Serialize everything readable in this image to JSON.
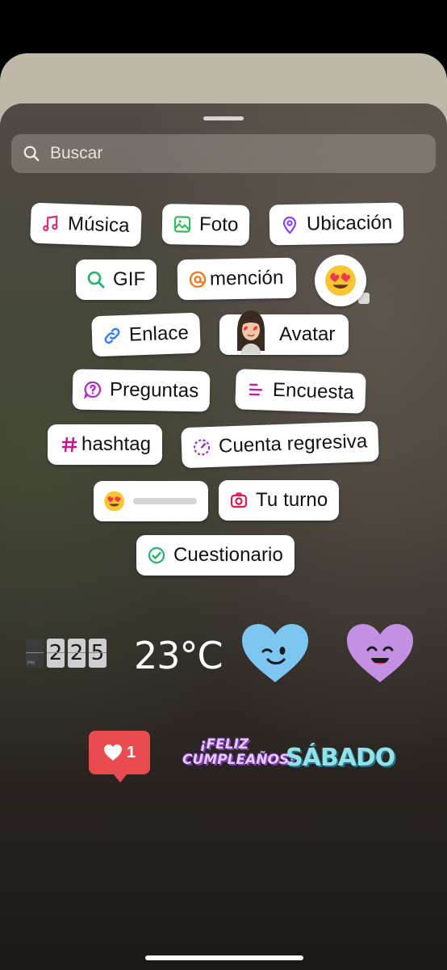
{
  "search": {
    "placeholder": "Buscar"
  },
  "stickers": {
    "musica": "Música",
    "foto": "Foto",
    "ubicacion": "Ubicación",
    "gif": "GIF",
    "mencion": "mención",
    "enlace": "Enlace",
    "avatar": "Avatar",
    "preguntas": "Preguntas",
    "encuesta": "Encuesta",
    "hashtag": "hashtag",
    "cuenta_regresiva": "Cuenta regresiva",
    "tu_turno": "Tu turno",
    "cuestionario": "Cuestionario"
  },
  "sticker_row": {
    "clock_digits": [
      "2",
      "2",
      "5"
    ],
    "clock_ampm": "PM",
    "temperature": "23°C",
    "likes_count": "1",
    "birthday_line1": "¡FELIZ",
    "birthday_line2": "CUMPLEAÑOS!",
    "weekday": "SÁBADO"
  },
  "colors": {
    "music_pink": "#e3287a",
    "photo_green": "#2fbd5a",
    "location_purple": "#8a3ffc",
    "gif_green": "#1fb56a",
    "threads_orange": "#f07a1a",
    "link_blue": "#2b7cff",
    "question_purple": "#b51fd1",
    "poll_pink": "#c91ca8",
    "hashtag_pink": "#c5148d",
    "countdown_purple": "#a22ad6",
    "camera_pink": "#e0184f",
    "quiz_green": "#1fb56a",
    "blue_heart": "#7ec6f2",
    "purple_heart": "#c490e4",
    "like_red": "#ea4b4e"
  }
}
